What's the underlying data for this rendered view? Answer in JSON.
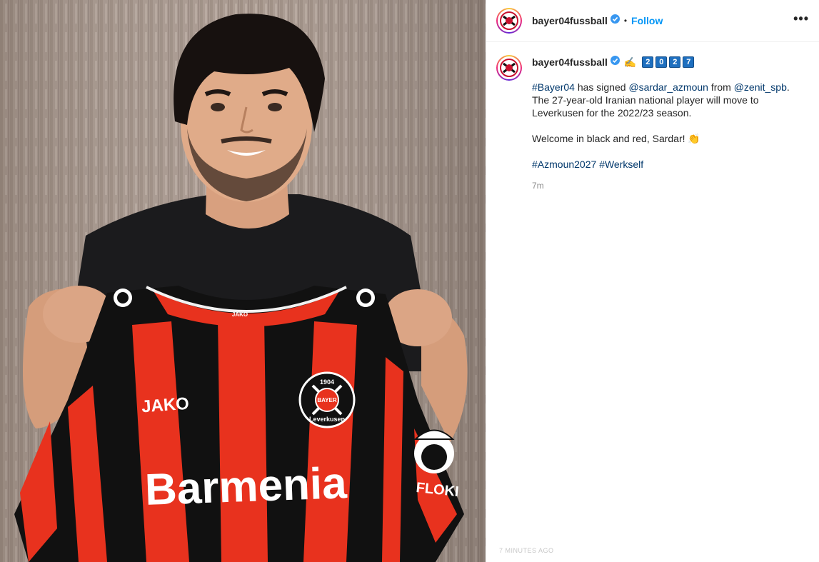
{
  "post": {
    "username": "bayer04fussball",
    "follow_label": "Follow",
    "more_label": "•••",
    "separator": "•"
  },
  "photo": {
    "jersey_brand": "JAKO",
    "jersey_sponsor": "Barmenia",
    "sleeve_sponsor": "FLOKI",
    "crest_year": "1904",
    "crest_top": "BAYER",
    "crest_bottom": "Leverkusen",
    "collar_brand": "JAKO"
  },
  "caption": {
    "username": "bayer04fussball",
    "emoji": "✍️",
    "year_digits": [
      "2",
      "0",
      "2",
      "7"
    ],
    "line1_tag": "#Bayer04",
    "line1_text1": " has signed ",
    "line1_mention1": "@sardar_azmoun",
    "line1_text2": " from ",
    "line1_mention2": "@zenit_spb",
    "line1_text3": ". The 27-year-old Iranian national player will move to Leverkusen for the 2022/23 season.",
    "line2_text": "Welcome in black and red, Sardar! ",
    "line2_emoji": "👏",
    "tag1": "#Azmoun2027",
    "tag2": "#Werkself",
    "time": "7m"
  },
  "overlay": {
    "faded_text": "7 MINUTES AGO"
  },
  "colors": {
    "follow_blue": "#0095f6",
    "link_navy": "#00376b",
    "jersey_red": "#e8321e",
    "jersey_black": "#111111",
    "verified_blue": "#3897f0"
  }
}
